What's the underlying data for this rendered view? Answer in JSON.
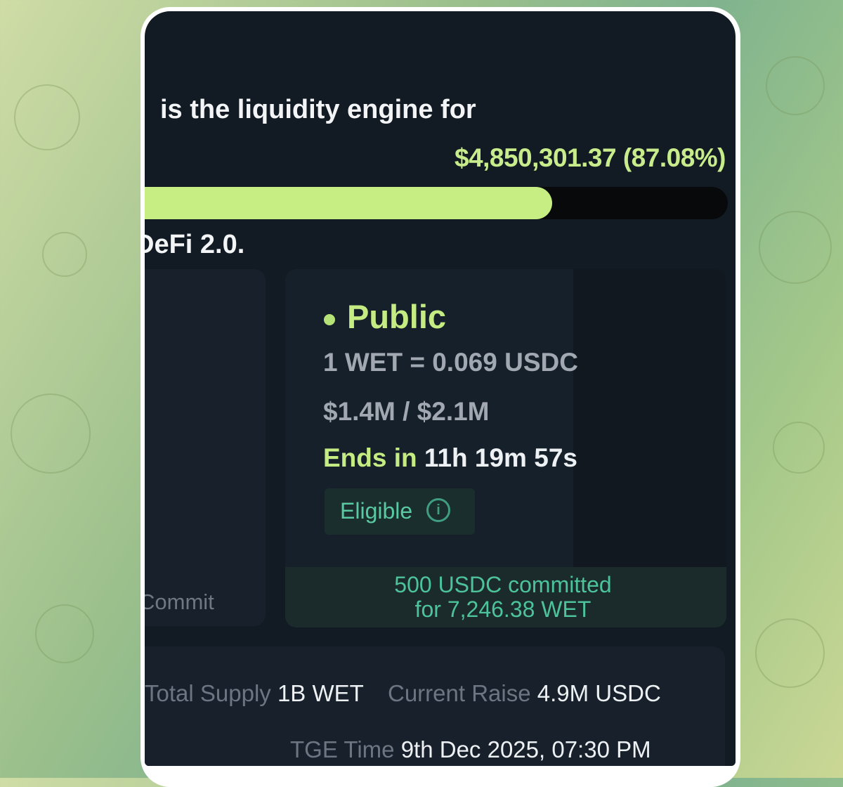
{
  "intro": {
    "line1": "is the liquidity engine for",
    "line2": "DeFi 2.0."
  },
  "raise": {
    "amount_text": "$4,850,301.37 (87.08%)",
    "progress_percent": 87.08
  },
  "left_panel": {
    "label": "Commit"
  },
  "phase": {
    "name": "Public",
    "price": "1 WET = 0.069 USDC",
    "cap": "$1.4M / $2.1M",
    "ends_label": "Ends in",
    "ends_time": "11h 19m 57s",
    "eligibility": "Eligible",
    "info_icon": "info-icon",
    "committed_line1": "500 USDC committed",
    "committed_line2": "for 7,246.38 WET"
  },
  "stats": {
    "supply_label": "Total Supply",
    "supply_value": "1B WET",
    "raise_label": "Current Raise",
    "raise_value": "4.9M USDC",
    "tge_label": "TGE Time",
    "tge_value": "9th Dec 2025, 07:30 PM"
  },
  "colors": {
    "accent_lime": "#c6ee82",
    "accent_green": "#4cc39a",
    "background_dark": "#121a23"
  }
}
